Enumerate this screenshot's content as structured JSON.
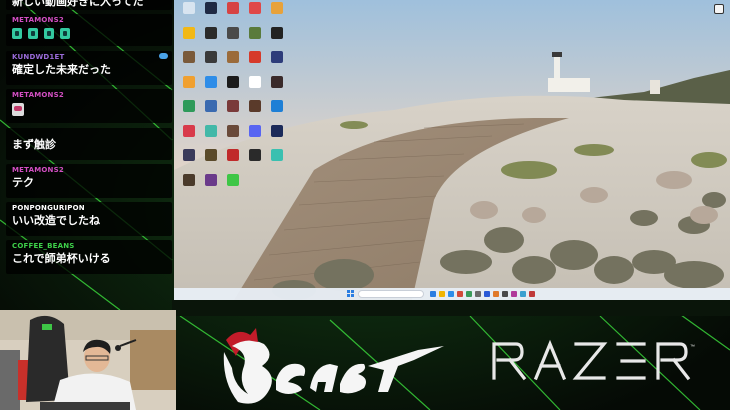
{
  "chat": {
    "messages": [
      {
        "user": "",
        "text": "新しい動画好きに入ってた",
        "user_color": "#ffffff"
      },
      {
        "user": "METAMONS2",
        "text": "",
        "emotes": 4,
        "user_color": "#d24fc2"
      },
      {
        "user": "KUNDWD1ET",
        "text": "確定した未来だった",
        "user_color": "#9a6bd9"
      },
      {
        "user": "METAMONS2",
        "text": "",
        "emotes": 1,
        "user_color": "#d24fc2"
      },
      {
        "user": "",
        "text": "まず触診",
        "user_color": "#ffffff"
      },
      {
        "user": "METAMONS2",
        "text": "テク",
        "user_color": "#d24fc2"
      },
      {
        "user": "PONPONGURIPON",
        "text": "いい改造でしたね",
        "user_color": "#ffffff"
      },
      {
        "user": "COFFEE_BEANS",
        "text": "これで師弟杯いける",
        "user_color": "#3ecf4a"
      }
    ]
  },
  "desktop": {
    "icons": [
      {
        "label": "",
        "color": "#d8e4f0",
        "icon": "recycle-bin-icon"
      },
      {
        "label": "",
        "color": "#1f2a44",
        "icon": "app-icon"
      },
      {
        "label": "",
        "color": "#d64343",
        "icon": "app-icon"
      },
      {
        "label": "",
        "color": "#e04848",
        "icon": "app-icon"
      },
      {
        "label": "",
        "color": "#e8a23a",
        "icon": "app-icon"
      },
      {
        "label": "",
        "color": "#f2b816",
        "icon": "app-icon"
      },
      {
        "label": "",
        "color": "#2b2b2b",
        "icon": "app-icon"
      },
      {
        "label": "",
        "color": "#4a4a4a",
        "icon": "app-icon"
      },
      {
        "label": "",
        "color": "#5a7b3c",
        "icon": "app-icon"
      },
      {
        "label": "",
        "color": "#222222",
        "icon": "app-icon"
      },
      {
        "label": "",
        "color": "#7a5a3a",
        "icon": "app-icon"
      },
      {
        "label": "",
        "color": "#3a3a3a",
        "icon": "app-icon"
      },
      {
        "label": "",
        "color": "#9b6b3a",
        "icon": "app-icon"
      },
      {
        "label": "",
        "color": "#d63a2a",
        "icon": "app-icon"
      },
      {
        "label": "",
        "color": "#2d3c7a",
        "icon": "app-icon"
      },
      {
        "label": "",
        "color": "#f0a030",
        "icon": "app-icon"
      },
      {
        "label": "",
        "color": "#2e8de8",
        "icon": "chrome-icon"
      },
      {
        "label": "",
        "color": "#1b1b1b",
        "icon": "app-icon"
      },
      {
        "label": "",
        "color": "#ffffff",
        "icon": "app-icon"
      },
      {
        "label": "",
        "color": "#3a2a2a",
        "icon": "app-icon"
      },
      {
        "label": "",
        "color": "#2e9a5a",
        "icon": "app-icon"
      },
      {
        "label": "",
        "color": "#3a6ab0",
        "icon": "app-icon"
      },
      {
        "label": "",
        "color": "#7a3a3a",
        "icon": "app-icon"
      },
      {
        "label": "",
        "color": "#5a3a2a",
        "icon": "app-icon"
      },
      {
        "label": "",
        "color": "#1d7fd6",
        "icon": "app-icon"
      },
      {
        "label": "",
        "color": "#d83a4a",
        "icon": "app-icon"
      },
      {
        "label": "",
        "color": "#42b8a8",
        "icon": "app-icon"
      },
      {
        "label": "",
        "color": "#6a4a3a",
        "icon": "app-icon"
      },
      {
        "label": "",
        "color": "#5865f2",
        "icon": "discord-icon"
      },
      {
        "label": "",
        "color": "#1b2a5a",
        "icon": "app-icon"
      },
      {
        "label": "",
        "color": "#3a3a5a",
        "icon": "app-icon"
      },
      {
        "label": "",
        "color": "#5a4a2a",
        "icon": "app-icon"
      },
      {
        "label": "",
        "color": "#c02a2a",
        "icon": "app-icon"
      },
      {
        "label": "",
        "color": "#2a2a2a",
        "icon": "app-icon"
      },
      {
        "label": "",
        "color": "#3ac0b0",
        "icon": "app-icon"
      },
      {
        "label": "",
        "color": "#4a3a2a",
        "icon": "app-icon"
      },
      {
        "label": "",
        "color": "#6a3a8a",
        "icon": "app-icon"
      },
      {
        "label": "",
        "color": "#3ec646",
        "icon": "line-icon"
      }
    ],
    "taskbar_apps": [
      "#2a7de1",
      "#f0b400",
      "#2e8de8",
      "#d24a3a",
      "#3a9a5a",
      "#6a6a6a",
      "#2a5ad6",
      "#e07a2a",
      "#4a4a4a",
      "#b03a9a",
      "#3aa0d0",
      "#c03a3a"
    ],
    "clock": {
      "time": "",
      "date": ""
    }
  },
  "colors": {
    "accent_green": "#3ecf4a",
    "banner_bg": "#0b1a0b",
    "razer_text": "#e8e8e8",
    "beast_red": "#c21c2a"
  }
}
